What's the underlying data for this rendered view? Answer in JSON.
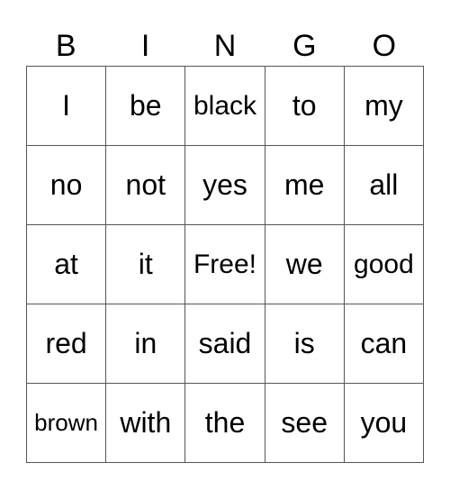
{
  "header": [
    "B",
    "I",
    "N",
    "G",
    "O"
  ],
  "rows": [
    [
      "I",
      "be",
      "black",
      "to",
      "my"
    ],
    [
      "no",
      "not",
      "yes",
      "me",
      "all"
    ],
    [
      "at",
      "it",
      "Free!",
      "we",
      "good"
    ],
    [
      "red",
      "in",
      "said",
      "is",
      "can"
    ],
    [
      "brown",
      "with",
      "the",
      "see",
      "you"
    ]
  ]
}
